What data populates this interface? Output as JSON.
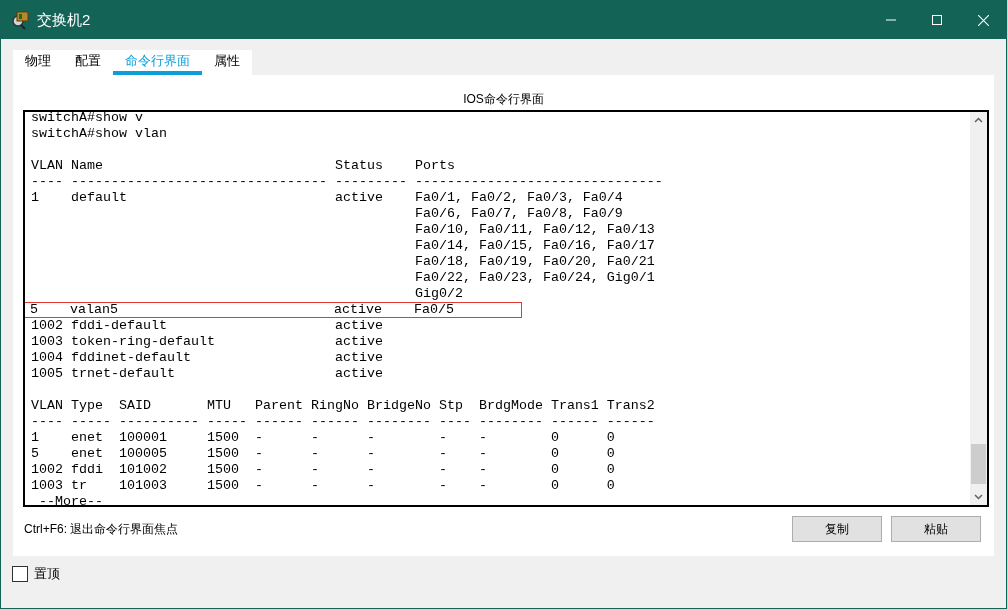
{
  "window": {
    "title": "交换机2"
  },
  "tabs": [
    {
      "label": "物理",
      "selected": false
    },
    {
      "label": "配置",
      "selected": false
    },
    {
      "label": "命令行界面",
      "selected": true
    },
    {
      "label": "属性",
      "selected": false
    }
  ],
  "panel_title": "IOS命令行界面",
  "terminal": {
    "lines": [
      {
        "text": "switchA#show v",
        "highlighted": false
      },
      {
        "text": "switchA#show vlan",
        "highlighted": false
      },
      {
        "text": "VLAN Name                             Status    Ports",
        "highlighted": false,
        "blank_line_before": true
      },
      {
        "text": "---- -------------------------------- --------- -------------------------------",
        "highlighted": false
      },
      {
        "text": "1    default                          active    Fa0/1, Fa0/2, Fa0/3, Fa0/4",
        "highlighted": false
      },
      {
        "text": "                                                Fa0/6, Fa0/7, Fa0/8, Fa0/9",
        "highlighted": false
      },
      {
        "text": "                                                Fa0/10, Fa0/11, Fa0/12, Fa0/13",
        "highlighted": false
      },
      {
        "text": "                                                Fa0/14, Fa0/15, Fa0/16, Fa0/17",
        "highlighted": false
      },
      {
        "text": "                                                Fa0/18, Fa0/19, Fa0/20, Fa0/21",
        "highlighted": false
      },
      {
        "text": "                                                Fa0/22, Fa0/23, Fa0/24, Gig0/1",
        "highlighted": false
      },
      {
        "text": "                                                Gig0/2",
        "highlighted": false
      },
      {
        "text": "5    valan5                           active    Fa0/5",
        "highlighted": true
      },
      {
        "text": "1002 fddi-default                     active",
        "highlighted": false
      },
      {
        "text": "1003 token-ring-default               active",
        "highlighted": false
      },
      {
        "text": "1004 fddinet-default                  active",
        "highlighted": false
      },
      {
        "text": "1005 trnet-default                    active",
        "highlighted": false
      },
      {
        "text": "VLAN Type  SAID       MTU   Parent RingNo BridgeNo Stp  BrdgMode Trans1 Trans2",
        "highlighted": false,
        "blank_line_before": true
      },
      {
        "text": "---- ----- ---------- ----- ------ ------ -------- ---- -------- ------ ------",
        "highlighted": false
      },
      {
        "text": "1    enet  100001     1500  -      -      -        -    -        0      0",
        "highlighted": false
      },
      {
        "text": "5    enet  100005     1500  -      -      -        -    -        0      0",
        "highlighted": false
      },
      {
        "text": "1002 fddi  101002     1500  -      -      -        -    -        0      0",
        "highlighted": false
      },
      {
        "text": "1003 tr    101003     1500  -      -      -        -    -        0      0",
        "highlighted": false
      },
      {
        "text": " --More--",
        "highlighted": false
      }
    ]
  },
  "hint": "Ctrl+F6: 退出命令行界面焦点",
  "buttons": [
    "复制",
    "粘贴"
  ],
  "always_on_top": {
    "label": "置顶",
    "checked": false
  }
}
